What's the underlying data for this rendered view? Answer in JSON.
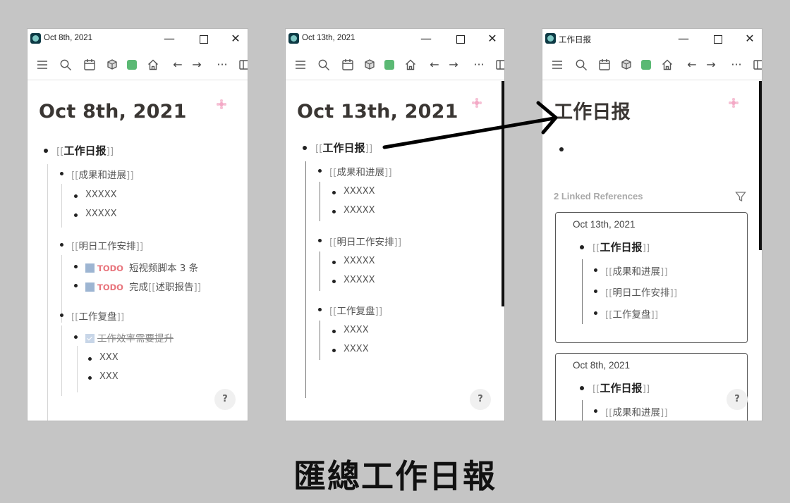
{
  "windows": [
    {
      "title": "Oct 8th, 2021",
      "page_title": "Oct 8th, 2021",
      "root_link": "工作日报",
      "sections": [
        {
          "link": "成果和进展",
          "items": [
            "XXXXX",
            "XXXXX"
          ]
        },
        {
          "link": "明日工作安排",
          "todos": [
            {
              "tag": "TODO",
              "text": "短视频脚本 3 条"
            },
            {
              "tag": "TODO",
              "text_prefix": "完成",
              "link": "述职报告"
            }
          ]
        },
        {
          "link": "工作复盘",
          "done_item": "工作效率需要提升",
          "sub_items": [
            "XXX",
            "XXX"
          ]
        }
      ]
    },
    {
      "title": "Oct 13th, 2021",
      "page_title": "Oct 13th, 2021",
      "root_link": "工作日报",
      "sections": [
        {
          "link": "成果和进展",
          "items": [
            "XXXXX",
            "XXXXX"
          ]
        },
        {
          "link": "明日工作安排",
          "items": [
            "XXXXX",
            "XXXXX"
          ]
        },
        {
          "link": "工作复盘",
          "items": [
            "XXXX",
            "XXXX"
          ]
        }
      ]
    },
    {
      "title": "工作日报",
      "page_title": "工作日报",
      "linked_refs_label": "2 Linked References",
      "refs": [
        {
          "date": "Oct 13th, 2021",
          "root_link": "工作日报",
          "children": [
            "成果和进展",
            "明日工作安排",
            "工作复盘"
          ]
        },
        {
          "date": "Oct 8th, 2021",
          "root_link": "工作日报",
          "children": [
            "成果和进展"
          ]
        }
      ]
    }
  ],
  "window_controls": {
    "minimize": "—",
    "close": "✕"
  },
  "toolbar_icons": [
    "menu-icon",
    "search-icon",
    "calendar-icon",
    "dice-icon",
    "green-square-icon",
    "home-icon",
    "arrow-left-icon",
    "arrow-right-icon",
    "more-icon",
    "sidebar-icon"
  ],
  "toolbar_glyphs": {
    "left": "←",
    "right": "→",
    "more": "···"
  },
  "help_label": "?",
  "caption": "匯總工作日報",
  "colors": {
    "background": "#c5c5c5",
    "todo": "#e8747c",
    "green": "#5bb974",
    "title": "#3a3633"
  }
}
